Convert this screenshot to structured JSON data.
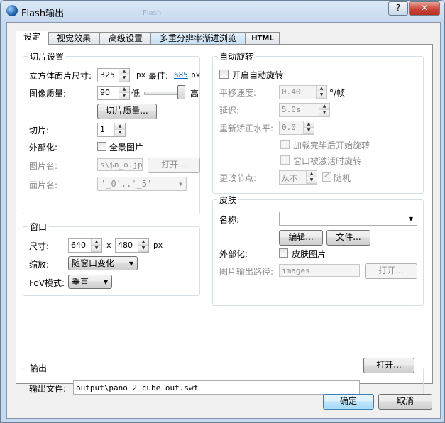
{
  "window": {
    "title": "Flash输出",
    "help_label": "?",
    "close_label": "✕",
    "bg_ghost": "Flash"
  },
  "tabs": [
    "设定",
    "视觉效果",
    "高级设置",
    "多重分辨率渐进浏览",
    "HTML"
  ],
  "slices": {
    "title": "切片设置",
    "cube_face_label": "立方体面片尺寸:",
    "cube_face_value": "325",
    "px": "px",
    "best_label": "最佳:",
    "best_value": "685",
    "image_quality_label": "图像质量:",
    "image_quality_value": "90",
    "quality_low": "低",
    "quality_high": "高",
    "quality_slider_level": 0.92,
    "slice_quality_button": "切片质量...",
    "slices_label": "切片:",
    "slices_value": "1",
    "externalize_label": "外部化:",
    "panorama_image_label": "全景图片",
    "image_name_label": "图片名:",
    "image_name_value": "s\\$n_o.jpg",
    "open_button": "打开...",
    "face_name_label": "面片名:",
    "face_name_value": "'_0'..'_5'"
  },
  "autorotate": {
    "title": "自动旋转",
    "enable_label": "开启自动旋转",
    "pan_speed_label": "平移速度:",
    "pan_speed_value": "0.40",
    "pan_speed_unit": "°/帧",
    "delay_label": "延迟:",
    "delay_value": "5.0s",
    "horizon_label": "重新矫正水平:",
    "horizon_value": "0.0",
    "start_after_load_label": "加载完毕后开始旋转",
    "start_when_active_label": "窗口被激活时旋转",
    "change_node_label": "更改节点:",
    "change_node_value": "从不",
    "random_label": "随机"
  },
  "window_group": {
    "title": "窗口",
    "size_label": "尺寸:",
    "width_value": "640",
    "x_label": "x",
    "height_value": "480",
    "px": "px",
    "scale_label": "缩放:",
    "scale_value": "随窗口变化",
    "fov_label": "FoV模式:",
    "fov_value": "垂直"
  },
  "skin": {
    "title": "皮肤",
    "name_label": "名称:",
    "name_value": "",
    "edit_button": "编辑...",
    "file_button": "文件...",
    "externalize_label": "外部化:",
    "skin_image_label": "皮肤图片",
    "image_path_label": "图片输出路径:",
    "image_path_value": "images",
    "open_button": "打开..."
  },
  "output": {
    "title": "输出",
    "file_label": "输出文件:",
    "file_value": "output\\pano_2_cube_out.swf",
    "open_button": "打开..."
  },
  "footer": {
    "ok": "确定",
    "cancel": "取消"
  }
}
